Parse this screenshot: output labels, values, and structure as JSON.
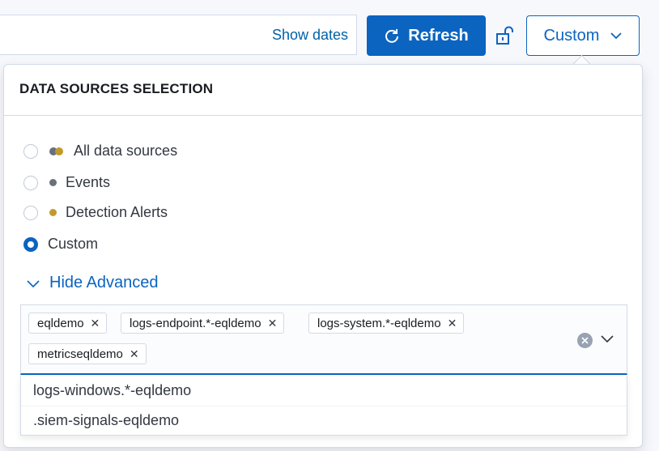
{
  "header": {
    "show_dates_label": "Show dates",
    "refresh_label": "Refresh",
    "custom_label": "Custom"
  },
  "popover": {
    "title": "DATA SOURCES SELECTION",
    "radio_options": [
      {
        "label": "All data sources",
        "checked": false,
        "dot": "dual"
      },
      {
        "label": "Events",
        "checked": false,
        "dot": "gray"
      },
      {
        "label": "Detection Alerts",
        "checked": false,
        "dot": "gold"
      },
      {
        "label": "Custom",
        "checked": true,
        "dot": "none"
      }
    ],
    "advanced_toggle_label": "Hide Advanced",
    "selected_indices": [
      "eqldemo",
      "logs-endpoint.*-eqldemo",
      "logs-system.*-eqldemo",
      "metricseqldemo"
    ],
    "dropdown_options": [
      "logs-windows.*-eqldemo",
      ".siem-signals-eqldemo"
    ]
  },
  "colors": {
    "primary": "#0b64c0",
    "events_dot": "#69707d",
    "alerts_dot": "#c29a2c"
  }
}
